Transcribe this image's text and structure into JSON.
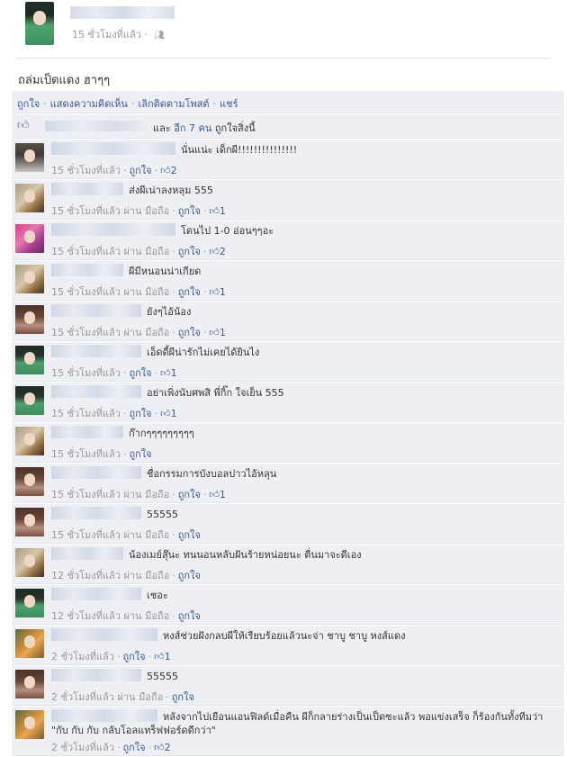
{
  "post": {
    "timestamp": "15 ชั่วโมงที่แล้ว",
    "audience_icon": "friends-icon",
    "status_text": "ถล่มเป็ดแดง ฮาๆๆ"
  },
  "actions": {
    "like": "ถูกใจ",
    "comment": "แสดงความคิดเห็น",
    "unfollow": "เลิกติดตามโพสต์",
    "share": "แชร์",
    "separator": "·"
  },
  "likes": {
    "icon": "thumbs-up-icon",
    "and_text": "และ ",
    "others_link": "อีก 7 คน",
    "suffix": " ถูกใจสิ่งนี้"
  },
  "comments": [
    {
      "text": "นั่นแน่ะ เด็กผี!!!!!!!!!!!!!!!",
      "time": "15 ชั่วโมงที่แล้ว",
      "via": "",
      "like_label": "ถูกใจ",
      "like_count": "2"
    },
    {
      "text": "ส่งผีเน่าลงหลุม 555",
      "time": "15 ชั่วโมงที่แล้ว",
      "via": "ผ่าน มือถือ",
      "like_label": "ถูกใจ",
      "like_count": "1"
    },
    {
      "text": "โดนไป 1-0 อ่อนๆๆอะ",
      "time": "15 ชั่วโมงที่แล้ว",
      "via": "ผ่าน มือถือ",
      "like_label": "ถูกใจ",
      "like_count": "2"
    },
    {
      "text": "ผีมีหนอนน่าเกียด",
      "time": "15 ชั่วโมงที่แล้ว",
      "via": "ผ่าน มือถือ",
      "like_label": "ถูกใจ",
      "like_count": "1"
    },
    {
      "text": "ยังๆไอ้น้อง",
      "time": "15 ชั่วโมงที่แล้ว",
      "via": "ผ่าน มือถือ",
      "like_label": "ถูกใจ",
      "like_count": "1"
    },
    {
      "text": "เอ็ดดี้ผีน่ารักไม่เคยได้ยินไง",
      "time": "15 ชั่วโมงที่แล้ว",
      "via": "",
      "like_label": "ถูกใจ",
      "like_count": "1"
    },
    {
      "text": "อย่าเพิ่งนับศพสิ พี่กิ๊ก ใจเย็น 555",
      "time": "15 ชั่วโมงที่แล้ว",
      "via": "",
      "like_label": "ถูกใจ",
      "like_count": "1"
    },
    {
      "text": "ก๊ากๆๆๆๆๆๆๆๆๆ",
      "time": "15 ชั่วโมงที่แล้ว",
      "via": "",
      "like_label": "ถูกใจ",
      "like_count": ""
    },
    {
      "text": "ชื่อกรรมการบังบอลปาวไอ้หลุน",
      "time": "15 ชั่วโมงที่แล้ว",
      "via": "ผ่าน มือถือ",
      "like_label": "ถูกใจ",
      "like_count": "1"
    },
    {
      "text": "55555",
      "time": "15 ชั่วโมงที่แล้ว",
      "via": "ผ่าน มือถือ",
      "like_label": "ถูกใจ",
      "like_count": ""
    },
    {
      "text": "น้องเมย์สุ๊นะ ทนนอนหลับฝันร้ายหน่อยนะ ตื่นมาจะดีเอง",
      "time": "12 ชั่วโมงที่แล้ว",
      "via": "ผ่าน มือถือ",
      "like_label": "ถูกใจ",
      "like_count": ""
    },
    {
      "text": "เชอะ",
      "time": "12 ชั่วโมงที่แล้ว",
      "via": "ผ่าน มือถือ",
      "like_label": "ถูกใจ",
      "like_count": ""
    },
    {
      "text": "หงส์ช่วยฝังกลบผีให้เรียบร้อยแล้วนะจ่า ชาบู ชาบู หงส์แดง",
      "time": "2 ชั่วโมงที่แล้ว",
      "via": "",
      "like_label": "ถูกใจ",
      "like_count": "1"
    },
    {
      "text": "55555",
      "time": "2 ชั่วโมงที่แล้ว",
      "via": "ผ่าน มือถือ",
      "like_label": "ถูกใจ",
      "like_count": ""
    },
    {
      "text": "หลังจากไปเยือนแอนฟิลด์เมื่อคืน ผีก็กลายร่างเป็นเป็ดซะแล้ว พอแข่งเสร็จ ก็ร้องกันทั้งทีมว่า \"กับ กับ กับ กลับโอลแทร็ฟฟอร์ดดีกว่า\"",
      "time": "2 ชั่วโมงที่แล้ว",
      "via": "",
      "like_label": "ถูกใจ",
      "like_count": "2"
    }
  ]
}
